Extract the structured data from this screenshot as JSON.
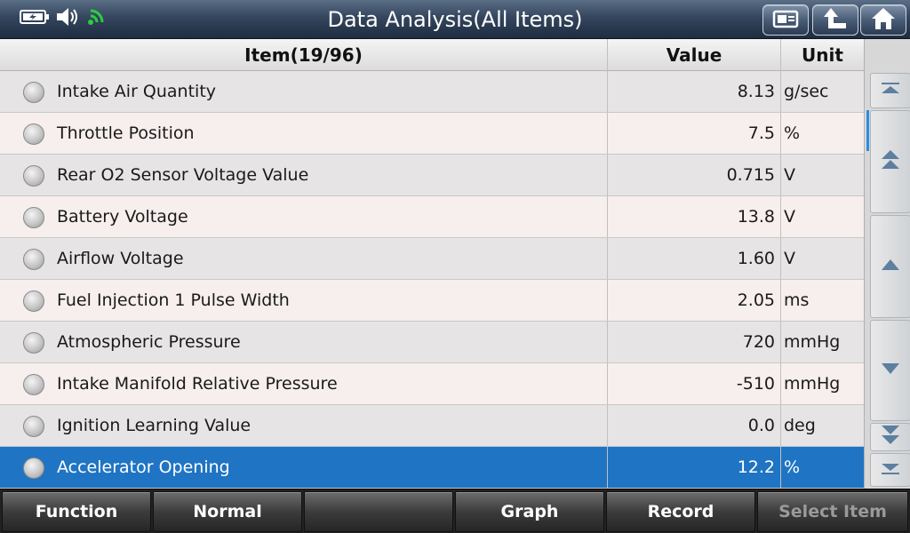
{
  "window": {
    "title": "Data Analysis(All Items)"
  },
  "status_icons": [
    "battery-icon",
    "speaker-icon",
    "wifi-icon"
  ],
  "toolbar_icons": [
    "screenshot-icon",
    "back-icon",
    "home-icon"
  ],
  "table": {
    "headers": {
      "item": "Item(19/96)",
      "value": "Value",
      "unit": "Unit"
    },
    "rows": [
      {
        "name": "Intake Air Quantity",
        "value": "8.13",
        "unit": "g/sec"
      },
      {
        "name": "Throttle Position",
        "value": "7.5",
        "unit": "%"
      },
      {
        "name": "Rear O2 Sensor Voltage Value",
        "value": "0.715",
        "unit": "V"
      },
      {
        "name": "Battery Voltage",
        "value": "13.8",
        "unit": "V"
      },
      {
        "name": "Airflow Voltage",
        "value": "1.60",
        "unit": "V"
      },
      {
        "name": "Fuel Injection 1 Pulse Width",
        "value": "2.05",
        "unit": "ms"
      },
      {
        "name": "Atmospheric Pressure",
        "value": "720",
        "unit": "mmHg"
      },
      {
        "name": "Intake Manifold Relative Pressure",
        "value": "-510",
        "unit": "mmHg"
      },
      {
        "name": "Ignition Learning Value",
        "value": "0.0",
        "unit": "deg"
      },
      {
        "name": "Accelerator Opening",
        "value": "12.2",
        "unit": "%"
      }
    ],
    "selected_row": "Accelerator Opening"
  },
  "scrollbar": {
    "buttons": [
      "scroll-top-icon",
      "page-up-icon",
      "line-up-icon",
      "line-down-icon",
      "page-down-icon",
      "scroll-bottom-icon"
    ]
  },
  "bottom_bar": {
    "function": "Function",
    "normal": "Normal",
    "empty": "",
    "graph": "Graph",
    "record": "Record",
    "select_item": "Select Item"
  },
  "colors": {
    "selected_row": "#1f74c4",
    "title_bar": "#34465e",
    "wifi": "#2ecc40"
  }
}
